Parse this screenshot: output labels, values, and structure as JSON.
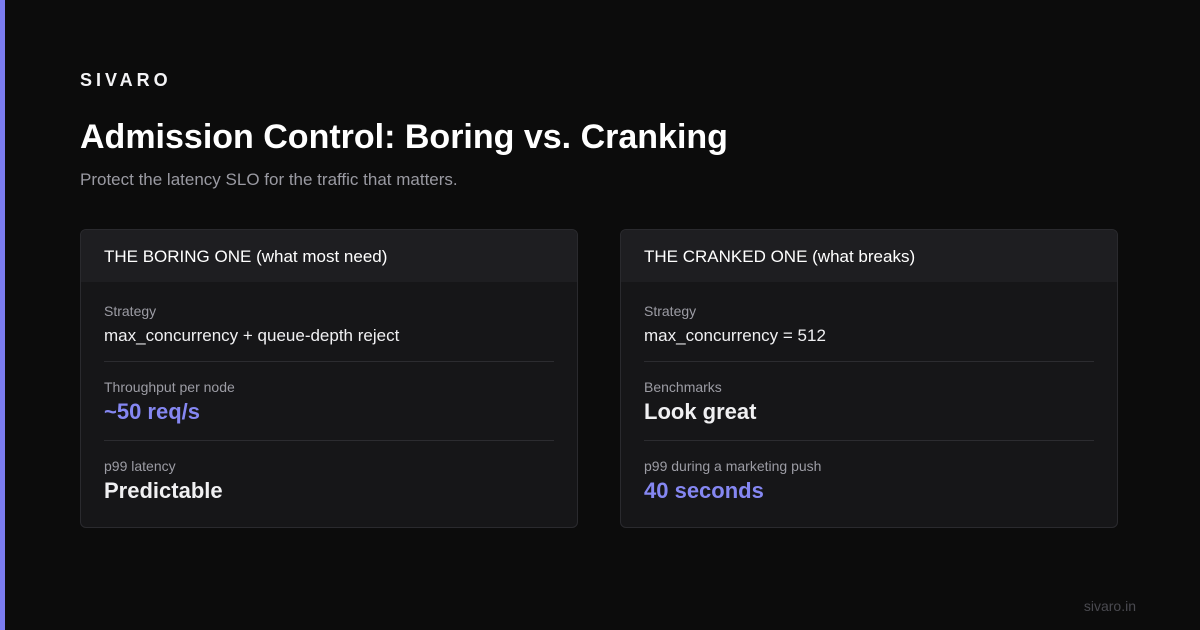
{
  "colors": {
    "background": "#0c0c0c",
    "accent": "#7b7cf0",
    "card": "#161618",
    "card_header": "#1e1e21"
  },
  "brand": "SIVARO",
  "title": "Admission Control: Boring vs. Cranking",
  "subtitle": "Protect the latency SLO for the traffic that matters.",
  "cards": [
    {
      "header": "THE BORING ONE (what most need)",
      "rows": [
        {
          "label": "Strategy",
          "value": "max_concurrency + queue-depth reject"
        },
        {
          "label": "Throughput per node",
          "value": "~50 req/s"
        },
        {
          "label": "p99 latency",
          "value": "Predictable"
        }
      ]
    },
    {
      "header": "THE CRANKED ONE (what breaks)",
      "rows": [
        {
          "label": "Strategy",
          "value": "max_concurrency = 512"
        },
        {
          "label": "Benchmarks",
          "value": "Look great"
        },
        {
          "label": "p99 during a marketing push",
          "value": "40 seconds"
        }
      ]
    }
  ],
  "footer": "sivaro.in"
}
